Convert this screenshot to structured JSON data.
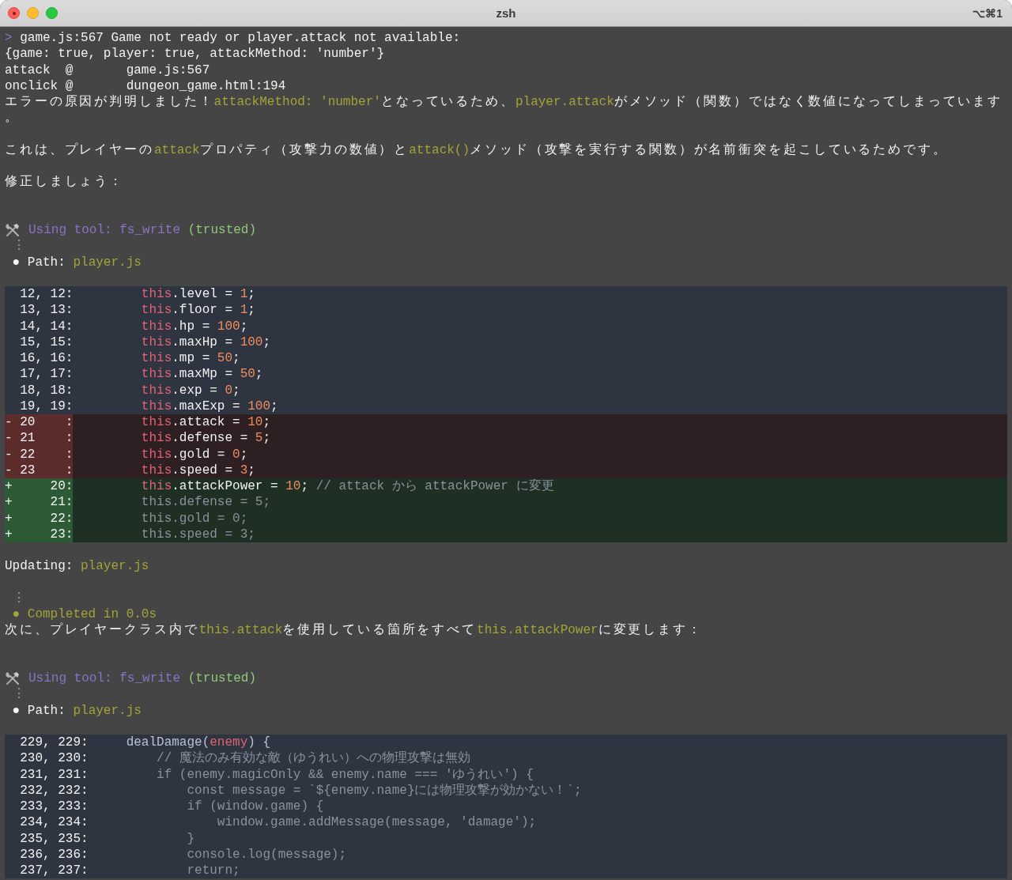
{
  "window": {
    "title": "zsh",
    "shortcut": "⌥⌘1"
  },
  "lines": [
    {
      "kind": "text",
      "segments": [
        {
          "kind": "prompt",
          "s": ">"
        },
        {
          "kind": "plain",
          "s": " game.js:567 Game not ready or player.attack not available:"
        }
      ]
    },
    {
      "kind": "text",
      "segments": [
        {
          "kind": "plain",
          "s": "{game: true, player: true, attackMethod: 'number'}"
        }
      ]
    },
    {
      "kind": "text",
      "segments": [
        {
          "kind": "plain",
          "s": "attack  @       game.js:567"
        }
      ]
    },
    {
      "kind": "text",
      "segments": [
        {
          "kind": "plain",
          "s": "onclick @       dungeon_game.html:194"
        }
      ]
    },
    {
      "kind": "jp",
      "segments": [
        {
          "kind": "plain",
          "s": "エラーの原因が判明しました！"
        },
        {
          "kind": "code",
          "s": "attackMethod: 'number'"
        },
        {
          "kind": "plain",
          "s": "となっているため、"
        },
        {
          "kind": "code",
          "s": "player.attack"
        },
        {
          "kind": "plain",
          "s": "がメソッド（関数）ではなく数値になってしまっています"
        }
      ]
    },
    {
      "kind": "jp",
      "segments": [
        {
          "kind": "plain",
          "s": "。"
        }
      ]
    },
    {
      "kind": "blank"
    },
    {
      "kind": "jp",
      "segments": [
        {
          "kind": "plain",
          "s": "これは、プレイヤーの"
        },
        {
          "kind": "code",
          "s": "attack"
        },
        {
          "kind": "plain",
          "s": "プロパティ（攻撃力の数値）と"
        },
        {
          "kind": "code",
          "s": "attack()"
        },
        {
          "kind": "plain",
          "s": "メソッド（攻撃を実行する関数）が名前衝突を起こしているためです。"
        }
      ]
    },
    {
      "kind": "blank"
    },
    {
      "kind": "jp",
      "segments": [
        {
          "kind": "plain",
          "s": "修正しましょう："
        }
      ]
    },
    {
      "kind": "blank"
    },
    {
      "kind": "blank"
    },
    {
      "kind": "tool",
      "segments": [
        {
          "kind": "tool",
          "s": "Using tool: fs_write"
        },
        {
          "kind": "trusted",
          "s": " (trusted)"
        }
      ]
    },
    {
      "kind": "dots",
      "segments": [
        {
          "kind": "dots",
          "s": " ⋮"
        }
      ]
    },
    {
      "kind": "text",
      "segments": [
        {
          "kind": "bullet",
          "s": " ●"
        },
        {
          "kind": "plain",
          "s": " Path: "
        },
        {
          "kind": "code",
          "s": "player.js"
        }
      ]
    },
    {
      "kind": "blank"
    },
    {
      "kind": "diff",
      "rows": [
        {
          "kind": "context",
          "gutter": "  12, 12:",
          "code": [
            {
              "kind": "kw",
              "s": "        this"
            },
            {
              "kind": "plain",
              "s": ".level = "
            },
            {
              "kind": "num",
              "s": "1"
            },
            {
              "kind": "plain",
              "s": ";"
            }
          ]
        },
        {
          "kind": "context",
          "gutter": "  13, 13:",
          "code": [
            {
              "kind": "kw",
              "s": "        this"
            },
            {
              "kind": "plain",
              "s": ".floor = "
            },
            {
              "kind": "num",
              "s": "1"
            },
            {
              "kind": "plain",
              "s": ";"
            }
          ]
        },
        {
          "kind": "context",
          "gutter": "  14, 14:",
          "code": [
            {
              "kind": "kw",
              "s": "        this"
            },
            {
              "kind": "plain",
              "s": ".hp = "
            },
            {
              "kind": "num",
              "s": "100"
            },
            {
              "kind": "plain",
              "s": ";"
            }
          ]
        },
        {
          "kind": "context",
          "gutter": "  15, 15:",
          "code": [
            {
              "kind": "kw",
              "s": "        this"
            },
            {
              "kind": "plain",
              "s": ".maxHp = "
            },
            {
              "kind": "num",
              "s": "100"
            },
            {
              "kind": "plain",
              "s": ";"
            }
          ]
        },
        {
          "kind": "context",
          "gutter": "  16, 16:",
          "code": [
            {
              "kind": "kw",
              "s": "        this"
            },
            {
              "kind": "plain",
              "s": ".mp = "
            },
            {
              "kind": "num",
              "s": "50"
            },
            {
              "kind": "plain",
              "s": ";"
            }
          ]
        },
        {
          "kind": "context",
          "gutter": "  17, 17:",
          "code": [
            {
              "kind": "kw",
              "s": "        this"
            },
            {
              "kind": "plain",
              "s": ".maxMp = "
            },
            {
              "kind": "num",
              "s": "50"
            },
            {
              "kind": "plain",
              "s": ";"
            }
          ]
        },
        {
          "kind": "context",
          "gutter": "  18, 18:",
          "code": [
            {
              "kind": "kw",
              "s": "        this"
            },
            {
              "kind": "plain",
              "s": ".exp = "
            },
            {
              "kind": "num",
              "s": "0"
            },
            {
              "kind": "plain",
              "s": ";"
            }
          ]
        },
        {
          "kind": "context",
          "gutter": "  19, 19:",
          "code": [
            {
              "kind": "kw",
              "s": "        this"
            },
            {
              "kind": "plain",
              "s": ".maxExp = "
            },
            {
              "kind": "num",
              "s": "100"
            },
            {
              "kind": "plain",
              "s": ";"
            }
          ]
        },
        {
          "kind": "removed",
          "gutter": "- 20    :",
          "code": [
            {
              "kind": "kw",
              "s": "        this"
            },
            {
              "kind": "plain",
              "s": ".attack = "
            },
            {
              "kind": "num",
              "s": "10"
            },
            {
              "kind": "plain",
              "s": ";"
            }
          ]
        },
        {
          "kind": "removed",
          "gutter": "- 21    :",
          "code": [
            {
              "kind": "kw",
              "s": "        this"
            },
            {
              "kind": "plain",
              "s": ".defense = "
            },
            {
              "kind": "num",
              "s": "5"
            },
            {
              "kind": "plain",
              "s": ";"
            }
          ]
        },
        {
          "kind": "removed",
          "gutter": "- 22    :",
          "code": [
            {
              "kind": "kw",
              "s": "        this"
            },
            {
              "kind": "plain",
              "s": ".gold = "
            },
            {
              "kind": "num",
              "s": "0"
            },
            {
              "kind": "plain",
              "s": ";"
            }
          ]
        },
        {
          "kind": "removed",
          "gutter": "- 23    :",
          "code": [
            {
              "kind": "kw",
              "s": "        this"
            },
            {
              "kind": "plain",
              "s": ".speed = "
            },
            {
              "kind": "num",
              "s": "3"
            },
            {
              "kind": "plain",
              "s": ";"
            }
          ]
        },
        {
          "kind": "added",
          "gutter": "+     20:",
          "code": [
            {
              "kind": "kw",
              "s": "        this"
            },
            {
              "kind": "plain",
              "s": ".attackPower = "
            },
            {
              "kind": "num",
              "s": "10"
            },
            {
              "kind": "plain",
              "s": "; "
            },
            {
              "kind": "cm",
              "s": "// attack から attackPower に変更"
            }
          ]
        },
        {
          "kind": "added",
          "gutter": "+     21:",
          "code": [
            {
              "kind": "dim",
              "s": "        this.defense = 5;"
            }
          ]
        },
        {
          "kind": "added",
          "gutter": "+     22:",
          "code": [
            {
              "kind": "dim",
              "s": "        this.gold = 0;"
            }
          ]
        },
        {
          "kind": "added",
          "gutter": "+     23:",
          "code": [
            {
              "kind": "dim",
              "s": "        this.speed = 3;"
            }
          ]
        }
      ]
    },
    {
      "kind": "blank"
    },
    {
      "kind": "text",
      "segments": [
        {
          "kind": "plain",
          "s": "Updating: "
        },
        {
          "kind": "code",
          "s": "player.js"
        }
      ]
    },
    {
      "kind": "blank"
    },
    {
      "kind": "dots",
      "segments": [
        {
          "kind": "dots",
          "s": " ⋮"
        }
      ]
    },
    {
      "kind": "text",
      "segments": [
        {
          "kind": "done",
          "s": " ● Completed in 0.0s"
        }
      ]
    },
    {
      "kind": "jp",
      "segments": [
        {
          "kind": "plain",
          "s": "次に、プレイヤークラス内で"
        },
        {
          "kind": "code",
          "s": "this.attack"
        },
        {
          "kind": "plain",
          "s": "を使用している箇所をすべて"
        },
        {
          "kind": "code",
          "s": "this.attackPower"
        },
        {
          "kind": "plain",
          "s": "に変更します："
        }
      ]
    },
    {
      "kind": "blank"
    },
    {
      "kind": "blank"
    },
    {
      "kind": "tool",
      "segments": [
        {
          "kind": "tool",
          "s": "Using tool: fs_write"
        },
        {
          "kind": "trusted",
          "s": " (trusted)"
        }
      ]
    },
    {
      "kind": "dots",
      "segments": [
        {
          "kind": "dots",
          "s": " ⋮"
        }
      ]
    },
    {
      "kind": "text",
      "segments": [
        {
          "kind": "bullet",
          "s": " ●"
        },
        {
          "kind": "plain",
          "s": " Path: "
        },
        {
          "kind": "code",
          "s": "player.js"
        }
      ]
    },
    {
      "kind": "blank"
    },
    {
      "kind": "diff",
      "rows": [
        {
          "kind": "context",
          "gutter": "  229, 229:",
          "code": [
            {
              "kind": "fn",
              "s": "    dealDamage("
            },
            {
              "kind": "param",
              "s": "enemy"
            },
            {
              "kind": "fn",
              "s": ") {"
            }
          ]
        },
        {
          "kind": "context",
          "gutter": "  230, 230:",
          "code": [
            {
              "kind": "dim",
              "s": "        // 魔法のみ有効な敵（ゆうれい）への物理攻撃は無効"
            }
          ]
        },
        {
          "kind": "context",
          "gutter": "  231, 231:",
          "code": [
            {
              "kind": "dim",
              "s": "        if (enemy.magicOnly && enemy.name === 'ゆうれい') {"
            }
          ]
        },
        {
          "kind": "context",
          "gutter": "  232, 232:",
          "code": [
            {
              "kind": "dim",
              "s": "            const message = `${enemy.name}には物理攻撃が効かない！`;"
            }
          ]
        },
        {
          "kind": "context",
          "gutter": "  233, 233:",
          "code": [
            {
              "kind": "dim",
              "s": "            if (window.game) {"
            }
          ]
        },
        {
          "kind": "context",
          "gutter": "  234, 234:",
          "code": [
            {
              "kind": "dim",
              "s": "                window.game.addMessage(message, 'damage');"
            }
          ]
        },
        {
          "kind": "context",
          "gutter": "  235, 235:",
          "code": [
            {
              "kind": "dim",
              "s": "            }"
            }
          ]
        },
        {
          "kind": "context",
          "gutter": "  236, 236:",
          "code": [
            {
              "kind": "dim",
              "s": "            console.log(message);"
            }
          ]
        },
        {
          "kind": "context",
          "gutter": "  237, 237:",
          "code": [
            {
              "kind": "dim",
              "s": "            return;"
            }
          ]
        }
      ]
    }
  ]
}
